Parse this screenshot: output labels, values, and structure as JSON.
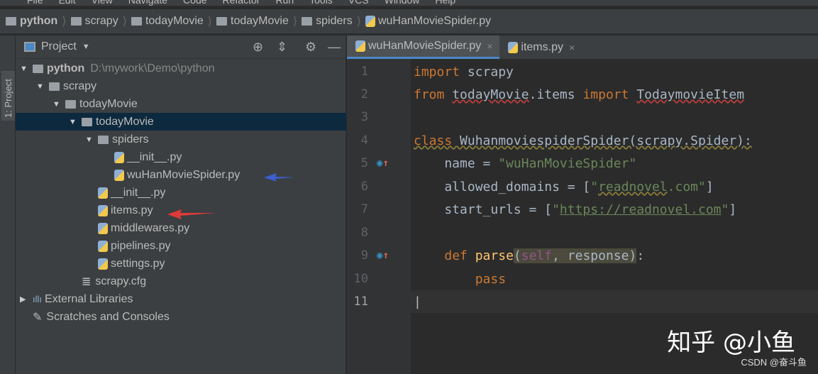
{
  "menu": [
    "File",
    "Edit",
    "View",
    "Navigate",
    "Code",
    "Refactor",
    "Run",
    "Tools",
    "VCS",
    "Window",
    "Help"
  ],
  "breadcrumb": [
    "python",
    "scrapy",
    "todayMovie",
    "todayMovie",
    "spiders",
    "wuHanMovieSpider.py"
  ],
  "stripe_label": "1: Project",
  "project": {
    "title": "Project",
    "tree": [
      {
        "label": "python",
        "path": "D:\\mywork\\Demo\\python",
        "type": "folder",
        "depth": 0,
        "expanded": true,
        "bold": true
      },
      {
        "label": "scrapy",
        "type": "folder",
        "depth": 1,
        "expanded": true
      },
      {
        "label": "todayMovie",
        "type": "folder",
        "depth": 2,
        "expanded": true
      },
      {
        "label": "todayMovie",
        "type": "folder",
        "depth": 3,
        "expanded": true,
        "selected": true
      },
      {
        "label": "spiders",
        "type": "folder",
        "depth": 4,
        "expanded": true
      },
      {
        "label": "__init__.py",
        "type": "py",
        "depth": 5
      },
      {
        "label": "wuHanMovieSpider.py",
        "type": "py",
        "depth": 5
      },
      {
        "label": "__init__.py",
        "type": "py",
        "depth": 4
      },
      {
        "label": "items.py",
        "type": "py",
        "depth": 4
      },
      {
        "label": "middlewares.py",
        "type": "py",
        "depth": 4
      },
      {
        "label": "pipelines.py",
        "type": "py",
        "depth": 4
      },
      {
        "label": "settings.py",
        "type": "py",
        "depth": 4
      },
      {
        "label": "scrapy.cfg",
        "type": "cfg",
        "depth": 3
      },
      {
        "label": "External Libraries",
        "type": "lib",
        "depth": 0,
        "collapsed": true
      },
      {
        "label": "Scratches and Consoles",
        "type": "scratch",
        "depth": 0
      }
    ]
  },
  "tabs": [
    {
      "label": "wuHanMovieSpider.py",
      "active": true
    },
    {
      "label": "items.py",
      "active": false
    }
  ],
  "code": {
    "line_numbers": [
      "1",
      "2",
      "3",
      "4",
      "5",
      "6",
      "7",
      "8",
      "9",
      "10",
      "11"
    ]
  },
  "watermark": "知乎 @小鱼",
  "csdn": "CSDN @奋斗鱼",
  "colors": {
    "keyword": "#cc7832",
    "string": "#6a8759",
    "selection": "#0d293e",
    "tab_underline": "#4a88c7",
    "arrow_blue": "#3a5fd0",
    "arrow_red": "#e03a3a"
  }
}
